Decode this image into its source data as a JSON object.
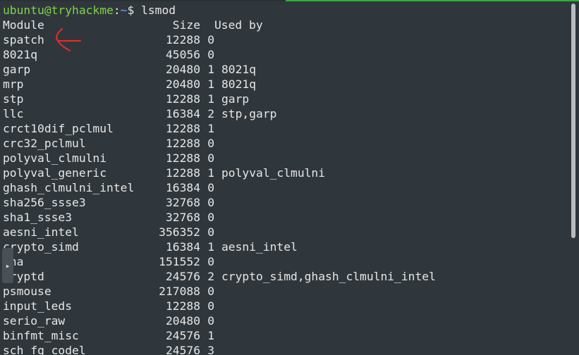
{
  "prompt": {
    "user": "ubuntu@tryhackme",
    "sep": ":",
    "path": "~",
    "symbol": "$ ",
    "command": "lsmod"
  },
  "header": {
    "module": "Module",
    "size": "Size",
    "used_by": "Used by"
  },
  "modules": [
    {
      "name": "spatch",
      "size": "12288",
      "used": "0",
      "by": ""
    },
    {
      "name": "8021q",
      "size": "45056",
      "used": "0",
      "by": ""
    },
    {
      "name": "garp",
      "size": "20480",
      "used": "1",
      "by": "8021q"
    },
    {
      "name": "mrp",
      "size": "20480",
      "used": "1",
      "by": "8021q"
    },
    {
      "name": "stp",
      "size": "12288",
      "used": "1",
      "by": "garp"
    },
    {
      "name": "llc",
      "size": "16384",
      "used": "2",
      "by": "stp,garp"
    },
    {
      "name": "crct10dif_pclmul",
      "size": "12288",
      "used": "1",
      "by": ""
    },
    {
      "name": "crc32_pclmul",
      "size": "12288",
      "used": "0",
      "by": ""
    },
    {
      "name": "polyval_clmulni",
      "size": "12288",
      "used": "0",
      "by": ""
    },
    {
      "name": "polyval_generic",
      "size": "12288",
      "used": "1",
      "by": "polyval_clmulni"
    },
    {
      "name": "ghash_clmulni_intel",
      "size": "16384",
      "used": "0",
      "by": ""
    },
    {
      "name": "sha256_ssse3",
      "size": "32768",
      "used": "0",
      "by": ""
    },
    {
      "name": "sha1_ssse3",
      "size": "32768",
      "used": "0",
      "by": ""
    },
    {
      "name": "aesni_intel",
      "size": "356352",
      "used": "0",
      "by": ""
    },
    {
      "name": "crypto_simd",
      "size": "16384",
      "used": "1",
      "by": "aesni_intel"
    },
    {
      "name": "cha",
      "size": "151552",
      "used": "0",
      "by": ""
    },
    {
      "name": "cryptd",
      "size": "24576",
      "used": "2",
      "by": "crypto_simd,ghash_clmulni_intel"
    },
    {
      "name": "psmouse",
      "size": "217088",
      "used": "0",
      "by": ""
    },
    {
      "name": "input_leds",
      "size": "12288",
      "used": "0",
      "by": ""
    },
    {
      "name": "serio_raw",
      "size": "20480",
      "used": "0",
      "by": ""
    },
    {
      "name": "binfmt_misc",
      "size": "24576",
      "used": "1",
      "by": ""
    },
    {
      "name": "sch_fq_codel",
      "size": "24576",
      "used": "3",
      "by": ""
    }
  ],
  "side_handle": {
    "glyph": "▸"
  },
  "colors": {
    "background": "#30373c",
    "prompt_user": "#7fd34a",
    "prompt_path": "#6ba7e8",
    "annotation": "#e0302a"
  },
  "icons": {
    "annotation": "red-arrow-icon",
    "handle": "expand-handle-icon"
  }
}
